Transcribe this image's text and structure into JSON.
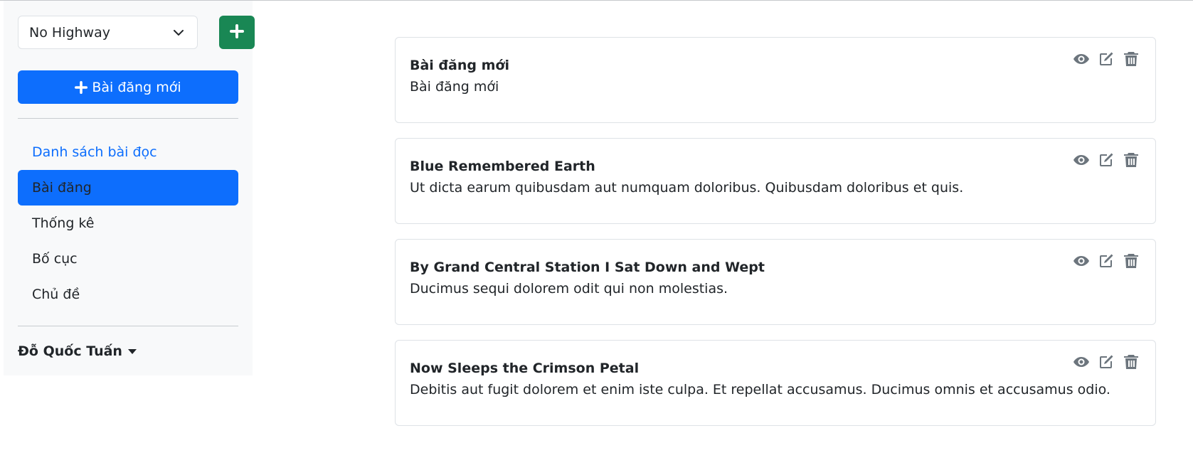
{
  "sidebar": {
    "blog_select": {
      "value": "No Highway",
      "icon": "chevron-down-icon"
    },
    "add_blog_button": {
      "icon": "plus-icon",
      "color": "#198754"
    },
    "new_post_button": {
      "label": "Bài đăng mới",
      "icon": "plus-icon",
      "color": "#0d6efd"
    },
    "nav": [
      {
        "label": "Danh sách bài đọc",
        "state": "link"
      },
      {
        "label": "Bài đăng",
        "state": "active"
      },
      {
        "label": "Thống kê",
        "state": "normal"
      },
      {
        "label": "Bố cục",
        "state": "normal"
      },
      {
        "label": "Chủ đề",
        "state": "normal"
      }
    ],
    "user": {
      "name": "Đỗ Quốc Tuấn",
      "icon": "caret-down-icon"
    }
  },
  "posts": [
    {
      "title": "Bài đăng mới",
      "excerpt": "Bài đăng mới"
    },
    {
      "title": "Blue Remembered Earth",
      "excerpt": "Ut dicta earum quibusdam aut numquam doloribus. Quibusdam doloribus et quis."
    },
    {
      "title": "By Grand Central Station I Sat Down and Wept",
      "excerpt": "Ducimus sequi dolorem odit qui non molestias."
    },
    {
      "title": "Now Sleeps the Crimson Petal",
      "excerpt": "Debitis aut fugit dolorem et enim iste culpa. Et repellat accusamus. Ducimus omnis et accusamus odio."
    }
  ],
  "post_actions": {
    "icons": [
      "eye-icon",
      "edit-icon",
      "trash-icon"
    ],
    "icon_color": "#6c757d"
  }
}
